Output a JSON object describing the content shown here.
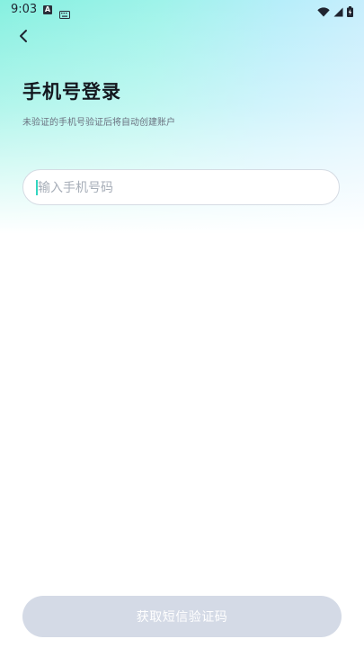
{
  "status_bar": {
    "time": "9:03",
    "notification_letter": "A"
  },
  "header": {
    "back_icon": "chevron-left-icon"
  },
  "page": {
    "title": "手机号登录",
    "subtitle": "未验证的手机号验证后将自动创建账户"
  },
  "form": {
    "phone_placeholder": "输入手机号码",
    "phone_value": ""
  },
  "actions": {
    "sms_button_label": "获取短信验证码"
  },
  "colors": {
    "accent": "#33d6c0",
    "button_disabled": "#d4dae6",
    "title": "#14181f"
  }
}
